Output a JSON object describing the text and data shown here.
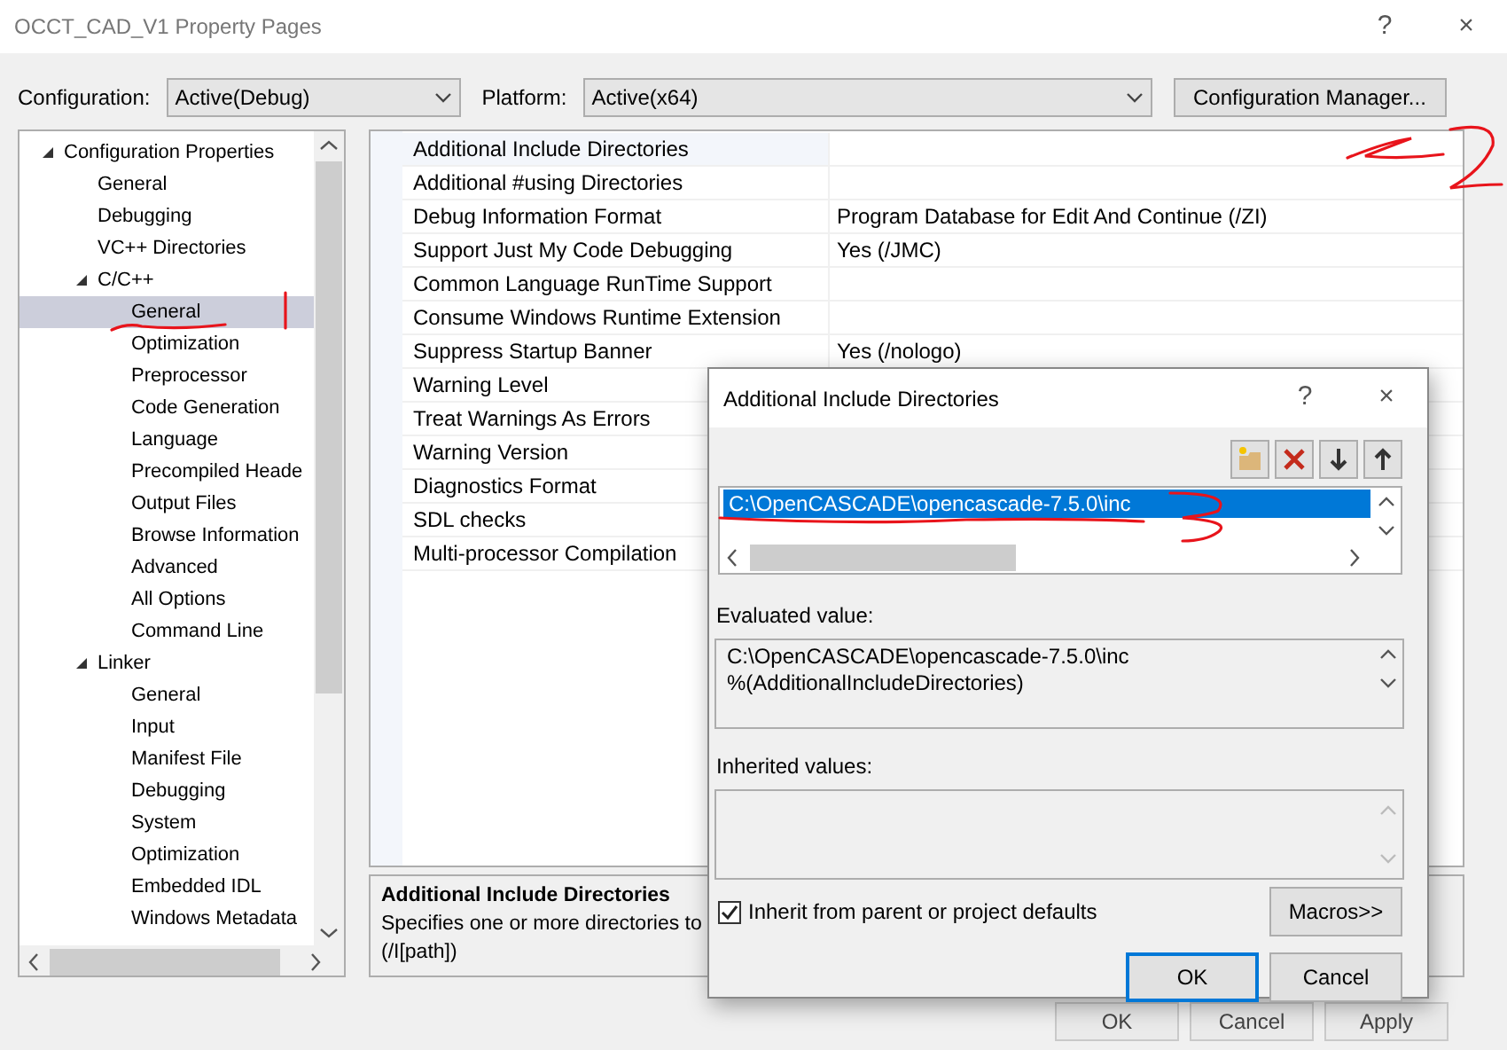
{
  "window": {
    "title": "OCCT_CAD_V1 Property Pages",
    "help": "?",
    "close": "×"
  },
  "toolbar": {
    "configuration": {
      "label": "Configuration:",
      "value": "Active(Debug)"
    },
    "platform": {
      "label": "Platform:",
      "value": "Active(x64)"
    },
    "manager_button": "Configuration Manager..."
  },
  "tree": [
    {
      "label": "Configuration Properties",
      "expanded": true,
      "selected": false,
      "children": [
        {
          "label": "General",
          "selected": false
        },
        {
          "label": "Debugging",
          "selected": false
        },
        {
          "label": "VC++ Directories",
          "selected": false
        },
        {
          "label": "C/C++",
          "expanded": true,
          "selected": false,
          "children": [
            {
              "label": "General",
              "selected": true
            },
            {
              "label": "Optimization",
              "selected": false
            },
            {
              "label": "Preprocessor",
              "selected": false
            },
            {
              "label": "Code Generation",
              "selected": false
            },
            {
              "label": "Language",
              "selected": false
            },
            {
              "label": "Precompiled Heade",
              "selected": false
            },
            {
              "label": "Output Files",
              "selected": false
            },
            {
              "label": "Browse Information",
              "selected": false
            },
            {
              "label": "Advanced",
              "selected": false
            },
            {
              "label": "All Options",
              "selected": false
            },
            {
              "label": "Command Line",
              "selected": false
            }
          ]
        },
        {
          "label": "Linker",
          "expanded": true,
          "selected": false,
          "children": [
            {
              "label": "General",
              "selected": false
            },
            {
              "label": "Input",
              "selected": false
            },
            {
              "label": "Manifest File",
              "selected": false
            },
            {
              "label": "Debugging",
              "selected": false
            },
            {
              "label": "System",
              "selected": false
            },
            {
              "label": "Optimization",
              "selected": false
            },
            {
              "label": "Embedded IDL",
              "selected": false
            },
            {
              "label": "Windows Metadata",
              "selected": false
            }
          ]
        }
      ]
    }
  ],
  "properties": [
    {
      "name": "Additional Include Directories",
      "selected": true
    },
    {
      "name": "Additional #using Directories",
      "selected": false
    },
    {
      "name": "Debug Information Format",
      "value": "Program Database for Edit And Continue (/ZI)",
      "selected": false
    },
    {
      "name": "Support Just My Code Debugging",
      "value": "Yes (/JMC)",
      "selected": false
    },
    {
      "name": "Common Language RunTime Support",
      "selected": false
    },
    {
      "name": "Consume Windows Runtime Extension",
      "selected": false
    },
    {
      "name": "Suppress Startup Banner",
      "value": "Yes (/nologo)",
      "selected": false
    },
    {
      "name": "Warning Level",
      "selected": false
    },
    {
      "name": "Treat Warnings As Errors",
      "selected": false
    },
    {
      "name": "Warning Version",
      "selected": false
    },
    {
      "name": "Diagnostics Format",
      "selected": false
    },
    {
      "name": "SDL checks",
      "selected": false
    },
    {
      "name": "Multi-processor Compilation",
      "selected": false
    }
  ],
  "description": {
    "title": "Additional Include Directories",
    "lines": [
      "Specifies one or more directories to",
      "(/I[path])"
    ]
  },
  "main_buttons": [
    "OK",
    "Cancel",
    "Apply"
  ],
  "dialog": {
    "title": "Additional Include Directories",
    "help": "?",
    "close": "×",
    "tools": [
      {
        "kind": "new-folder"
      },
      {
        "kind": "delete"
      },
      {
        "kind": "down"
      },
      {
        "kind": "up"
      }
    ],
    "entries": [
      {
        "text": "C:\\OpenCASCADE\\opencascade-7.5.0\\inc",
        "selected": true
      }
    ],
    "evaluated_label": "Evaluated value:",
    "evaluated_lines": [
      "C:\\OpenCASCADE\\opencascade-7.5.0\\inc",
      "%(AdditionalIncludeDirectories)"
    ],
    "inherited_label": "Inherited values:",
    "inherit": {
      "label": "Inherit from parent or project defaults",
      "checked": true
    },
    "macros_button": "Macros>>",
    "ok": "OK",
    "cancel": "Cancel"
  }
}
